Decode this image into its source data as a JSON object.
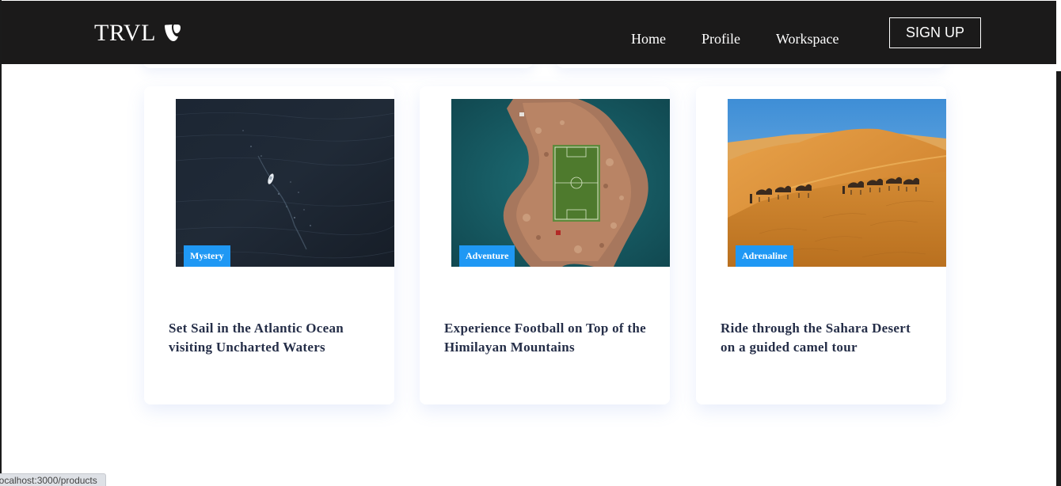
{
  "nav": {
    "logo_text": "TRVL",
    "logo_icon": "typo3-icon",
    "links": [
      "Home",
      "Profile",
      "Workspace"
    ],
    "signup_label": "SIGN UP",
    "background": "#1b1a1a"
  },
  "cards": [
    {
      "tag": "Mystery",
      "title": "Set Sail in the Atlantic Ocean visiting Uncharted Waters",
      "image": "ocean-boat-image"
    },
    {
      "tag": "Adventure",
      "title": "Experience Football on Top of the Himilayan Mountains",
      "image": "island-football-field-image"
    },
    {
      "tag": "Adrenaline",
      "title": "Ride through the Sahara Desert on a guided camel tour",
      "image": "desert-camels-image"
    }
  ],
  "tag_color": "#1f98f4",
  "status_bar": {
    "url": "localhost:3000/products"
  }
}
